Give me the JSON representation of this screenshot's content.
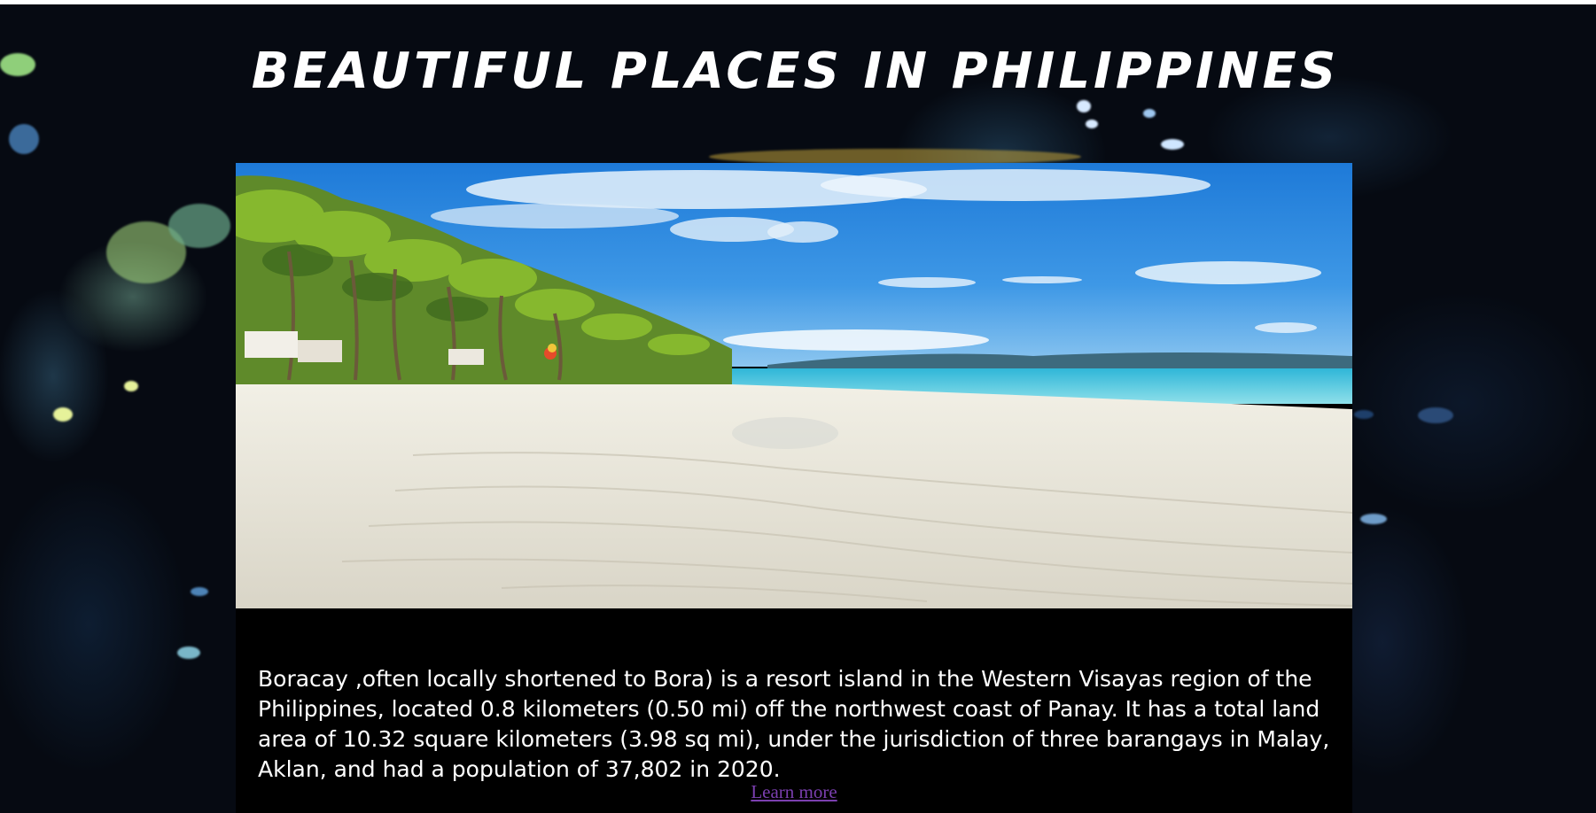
{
  "page": {
    "title": "BEAUTIFUL PLACES IN PHILIPPINES"
  },
  "hero": {
    "image_alt": "Boracay white sand beach with palm trees"
  },
  "article": {
    "description": "Boracay ,often locally shortened to Bora) is a resort island in the Western Visayas region of the Philippines, located 0.8 kilometers (0.50 mi) off the northwest coast of Panay. It has a total land area of 10.32 square kilometers (3.98 sq mi), under the jurisdiction of three barangays in Malay, Aklan, and had a population of 37,802 in 2020.",
    "learn_more_label": "Learn more"
  },
  "colors": {
    "background": "#060a12",
    "card": "#000000",
    "link_visited": "#7b3fb0",
    "text": "#ffffff"
  }
}
